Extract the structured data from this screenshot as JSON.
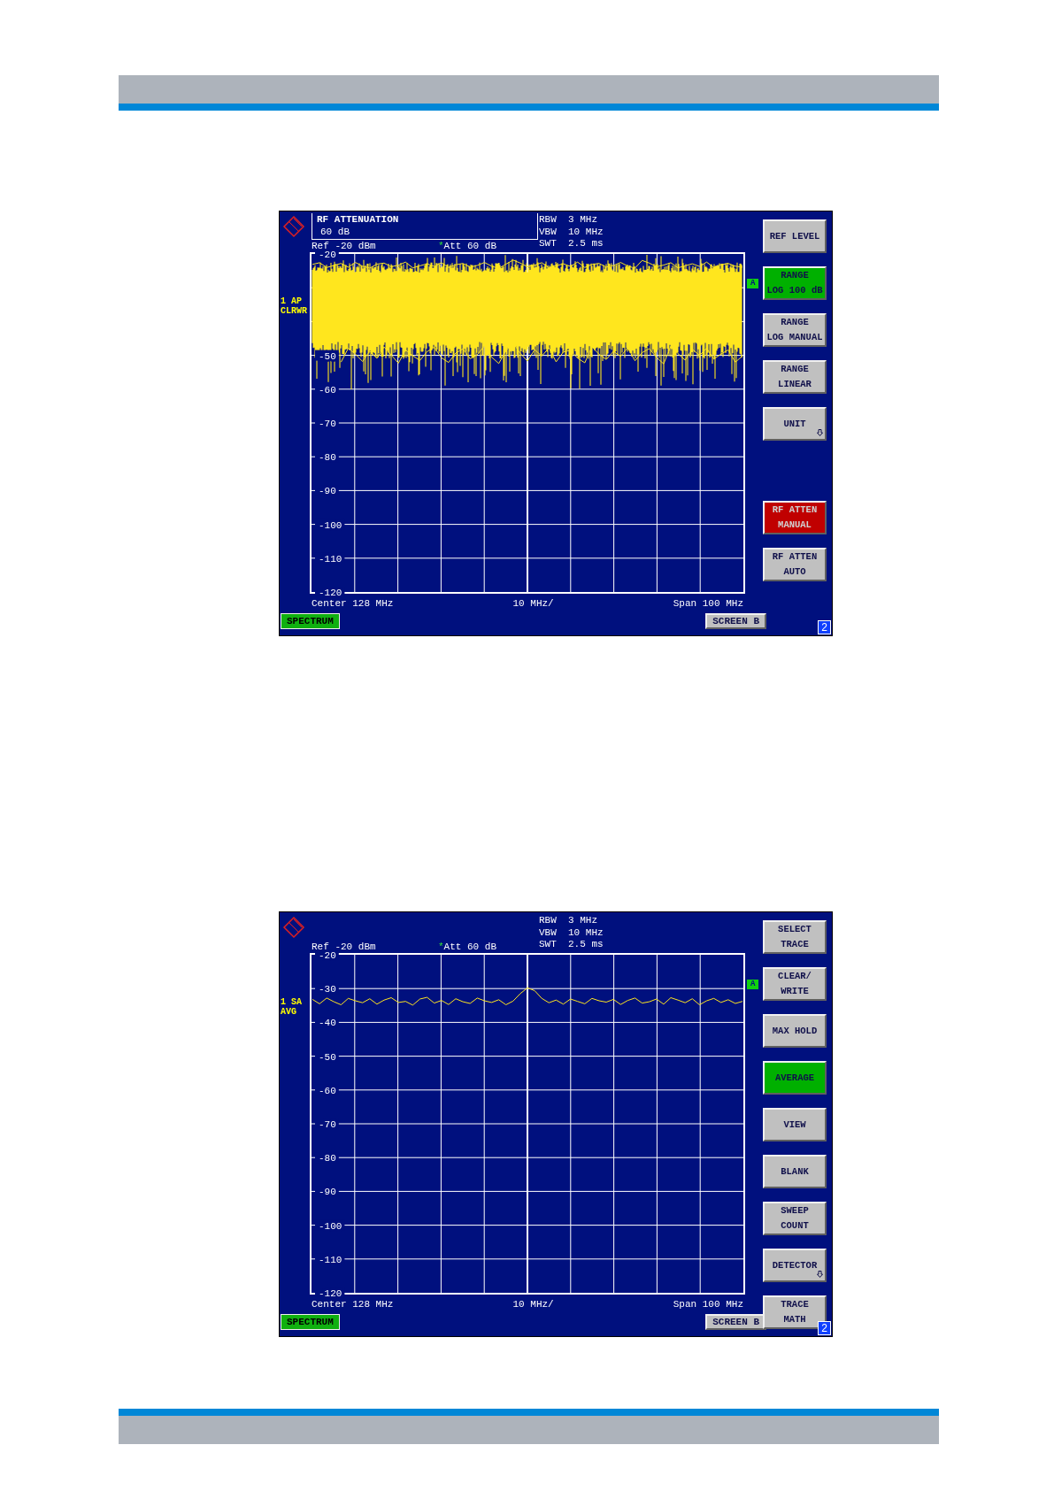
{
  "screens": [
    {
      "input_box": {
        "title": "RF ATTENUATION",
        "value": "60 dB"
      },
      "ref": "Ref -20 dBm",
      "att_mark": "*",
      "att": "Att  60 dB",
      "settings": [
        {
          "label": "RBW",
          "value": "3 MHz"
        },
        {
          "label": "VBW",
          "value": "10 MHz"
        },
        {
          "label": "SWT",
          "value": "2.5 ms"
        }
      ],
      "trace_label": [
        "1 AP",
        "CLRWR"
      ],
      "trace_badge": "A",
      "trace": {
        "kind": "band"
      },
      "chart_data": {
        "type": "line",
        "grid": true,
        "ylim": [
          -120,
          -20
        ],
        "yticks": [
          -20,
          -50,
          -60,
          -70,
          -80,
          -90,
          -100,
          -110,
          -120
        ],
        "series": [
          {
            "color": "#ffe61e",
            "values": [
              -23.1,
              -22.6,
              -24.0,
              -23.4,
              -22.8,
              -23.9,
              -22.5,
              -23.6,
              -24.2,
              -23.0,
              -22.7,
              -23.8,
              -23.3,
              -22.4,
              -24.1,
              -23.5,
              -22.9,
              -23.7,
              -22.6,
              -24.0,
              -23.2,
              -22.8,
              -23.9,
              -23.4,
              -22.5,
              -23.6,
              -24.3,
              -23.0,
              -21.8,
              -22.7,
              -23.8,
              -23.3,
              -22.6,
              -24.1,
              -23.5,
              -22.9,
              -23.7,
              -22.4,
              -24.0,
              -23.1,
              -22.8,
              -23.9,
              -23.4,
              -22.5,
              -23.6,
              -24.2,
              -21.9,
              -22.7,
              -23.8,
              -23.3,
              -22.6,
              -24.1,
              -23.5,
              -22.9,
              -23.7,
              -22.4,
              -24.0,
              -23.2,
              -22.8,
              -23.6,
              -23.9
            ]
          },
          {
            "color": "#ffe61e",
            "values": [
              null,
              null,
              null,
              null,
              -52.0,
              -47.9,
              -49.6,
              -51.8,
              -48.7,
              -50.9,
              -47.5,
              -49.9,
              -52.3,
              -48.4,
              -50.1,
              -51.5,
              -48.9,
              -47.6,
              -50.7,
              -52.1,
              -49.3,
              -48.1,
              -51.0,
              -49.8,
              -47.2,
              -50.5,
              -52.4,
              -48.6,
              -46.3,
              -49.4,
              -51.7,
              -48.3,
              -50.2,
              -47.8,
              -51.9,
              -49.0,
              -48.5,
              -50.8,
              -52.2,
              -47.4,
              -49.7,
              -51.2,
              -48.8,
              -50.3,
              -47.7,
              -51.6,
              -49.2,
              -48.0,
              -50.6,
              -52.5,
              -47.3,
              -49.5,
              -51.4,
              -48.2,
              -50.0,
              -47.9,
              -51.1,
              -49.6,
              -48.4,
              -52.0,
              -50.2
            ]
          }
        ]
      },
      "x_labels": {
        "start": "Center 128 MHz",
        "division": "10 MHz/",
        "span": "Span 100 MHz"
      },
      "mode": "SPECTRUM",
      "screen": "SCREEN B",
      "screen_number": "2",
      "softkeys": [
        {
          "kind": "key",
          "lines": [
            "REF LEVEL"
          ],
          "color": "#c0c0c0",
          "submenu": false
        },
        {
          "kind": "key",
          "lines": [
            "RANGE",
            "LOG 100 dB"
          ],
          "color": "#00b000",
          "submenu": false
        },
        {
          "kind": "key",
          "lines": [
            "RANGE",
            "LOG MANUAL"
          ],
          "color": "#c0c0c0",
          "submenu": false
        },
        {
          "kind": "key",
          "lines": [
            "RANGE",
            "LINEAR"
          ],
          "color": "#c0c0c0",
          "submenu": false
        },
        {
          "kind": "key",
          "lines": [
            "UNIT"
          ],
          "color": "#c0c0c0",
          "submenu": true
        },
        {
          "kind": "blank"
        },
        {
          "kind": "key",
          "lines": [
            "RF ATTEN",
            "MANUAL"
          ],
          "color": "#c00000",
          "submenu": false
        },
        {
          "kind": "key",
          "lines": [
            "RF ATTEN",
            "AUTO"
          ],
          "color": "#c0c0c0",
          "submenu": false
        }
      ]
    },
    {
      "ref": "Ref -20 dBm",
      "att_mark": "*",
      "att": "Att  60 dB",
      "settings": [
        {
          "label": "RBW",
          "value": "3 MHz"
        },
        {
          "label": "VBW",
          "value": "10 MHz"
        },
        {
          "label": "SWT",
          "value": "2.5 ms"
        }
      ],
      "trace_label": [
        "1 SA",
        "AVG"
      ],
      "trace_badge": "A",
      "trace": {
        "kind": "line"
      },
      "chart_data": {
        "type": "line",
        "grid": true,
        "ylim": [
          -120,
          -20
        ],
        "yticks": [
          -20,
          -30,
          -40,
          -50,
          -60,
          -70,
          -80,
          -90,
          -100,
          -110,
          -120
        ],
        "series": [
          {
            "color": "#ffe61e",
            "values": [
              -33.2,
              -34.5,
              -32.8,
              -33.9,
              -34.8,
              -32.9,
              -33.6,
              -34.2,
              -33.0,
              -34.6,
              -33.4,
              -32.7,
              -34.1,
              -33.8,
              -34.9,
              -33.1,
              -32.6,
              -34.3,
              -33.5,
              -34.7,
              -33.0,
              -33.9,
              -34.4,
              -32.8,
              -33.6,
              -34.1,
              -33.3,
              -34.8,
              -33.7,
              -31.5,
              -29.8,
              -30.6,
              -32.9,
              -34.2,
              -33.4,
              -34.6,
              -33.1,
              -33.8,
              -34.5,
              -32.9,
              -33.6,
              -34.0,
              -33.2,
              -34.7,
              -33.5,
              -32.8,
              -34.3,
              -33.9,
              -33.1,
              -34.6,
              -32.7,
              -33.4,
              -34.2,
              -33.0,
              -34.8,
              -33.6,
              -32.9,
              -34.1,
              -33.3,
              -34.4,
              -33.8
            ]
          }
        ]
      },
      "x_labels": {
        "start": "Center 128 MHz",
        "division": "10 MHz/",
        "span": "Span 100 MHz"
      },
      "mode": "SPECTRUM",
      "screen": "SCREEN B",
      "screen_number": "2",
      "softkeys": [
        {
          "kind": "key",
          "lines": [
            "SELECT",
            "TRACE"
          ],
          "color": "#c0c0c0",
          "submenu": false
        },
        {
          "kind": "key",
          "lines": [
            "CLEAR/",
            "WRITE"
          ],
          "color": "#c0c0c0",
          "submenu": false
        },
        {
          "kind": "key",
          "lines": [
            "MAX HOLD"
          ],
          "color": "#c0c0c0",
          "submenu": false
        },
        {
          "kind": "key",
          "lines": [
            "AVERAGE"
          ],
          "color": "#00b000",
          "submenu": false
        },
        {
          "kind": "key",
          "lines": [
            "VIEW"
          ],
          "color": "#c0c0c0",
          "submenu": false
        },
        {
          "kind": "key",
          "lines": [
            "BLANK"
          ],
          "color": "#c0c0c0",
          "submenu": false
        },
        {
          "kind": "key",
          "lines": [
            "SWEEP",
            "COUNT"
          ],
          "color": "#c0c0c0",
          "submenu": false
        },
        {
          "kind": "key",
          "lines": [
            "DETECTOR"
          ],
          "color": "#c0c0c0",
          "submenu": true
        },
        {
          "kind": "key",
          "lines": [
            "TRACE",
            "MATH"
          ],
          "color": "#c0c0c0",
          "submenu": false
        }
      ]
    }
  ]
}
